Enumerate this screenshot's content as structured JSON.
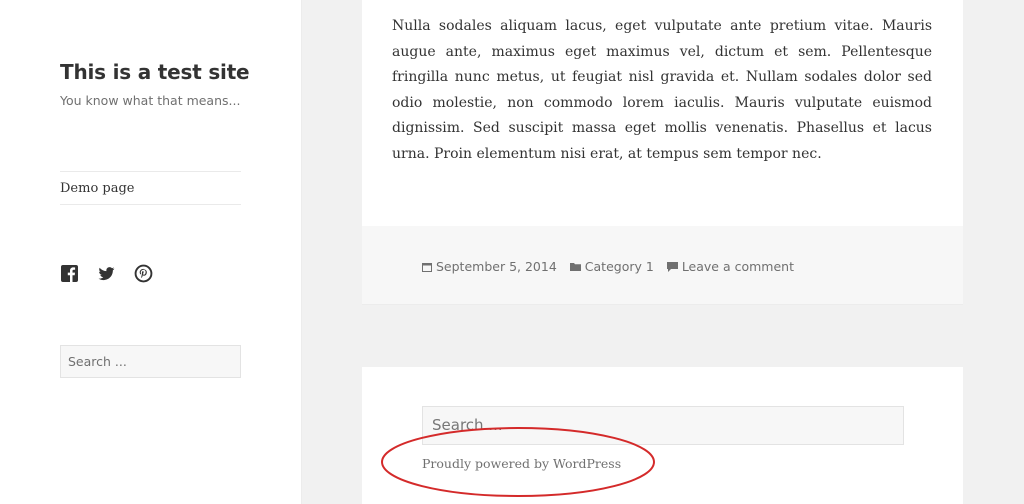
{
  "site": {
    "title": "This is a test site",
    "description": "You know what that means..."
  },
  "nav": {
    "items": [
      {
        "label": "Demo page"
      }
    ]
  },
  "social": {
    "icons": [
      "facebook-icon",
      "twitter-icon",
      "pinterest-icon"
    ]
  },
  "sidebar_search": {
    "placeholder": "Search ..."
  },
  "post": {
    "body": "Nulla sodales aliquam lacus, eget vulputate ante pretium vitae. Mauris augue ante, maximus eget maximus vel, dictum et sem. Pellentesque fringilla nunc metus, ut feugiat nisl gravida et. Nullam sodales dolor sed odio molestie, non commodo lorem iaculis. Mauris vulputate euismod dignissim. Sed suscipit massa eget mollis venenatis. Phasellus et lacus urna. Proin elementum nisi erat, at tempus sem tempor nec.",
    "meta": {
      "date": "September 5, 2014",
      "category": "Category 1",
      "comments": "Leave a comment"
    }
  },
  "footer": {
    "search_placeholder": "Search ...",
    "credit": "Proudly powered by WordPress"
  },
  "annotation": {
    "color": "#d42a2a"
  }
}
